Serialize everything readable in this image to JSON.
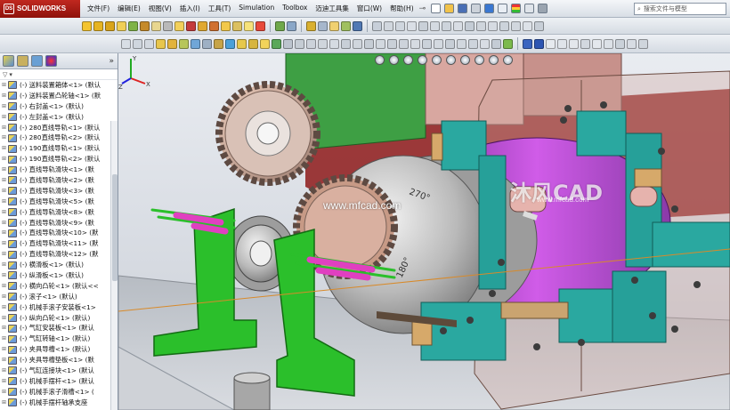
{
  "app": {
    "name": "SOLIDWORKS",
    "ds_mark": "DS"
  },
  "menu": {
    "items": [
      "文件(F)",
      "编辑(E)",
      "视图(V)",
      "插入(I)",
      "工具(T)",
      "Simulation",
      "Toolbox",
      "迈迪工具集",
      "窗口(W)",
      "帮助(H)"
    ]
  },
  "search": {
    "placeholder": "搜索文件与模型"
  },
  "feature_tree": {
    "items": [
      "(-) 送料装置箱体<1> (默认",
      "(-) 送料装置凸轮轴<1> (默",
      "(-) 右封盖<1> (默认)",
      "(-) 左封盖<1> (默认)",
      "(-) 280直线导轨<1> (默认",
      "(-) 280直线导轨<2> (默认",
      "(-) 190直线导轨<1> (默认",
      "(-) 190直线导轨<2> (默认",
      "(-) 直线导轨滑块<1> (默",
      "(-) 直线导轨滑块<2> (默",
      "(-) 直线导轨滑块<3> (默",
      "(-) 直线导轨滑块<5> (默",
      "(-) 直线导轨滑块<8> (默",
      "(-) 直线导轨滑块<9> (默",
      "(-) 直线导轨滑块<10> (默",
      "(-) 直线导轨滑块<11> (默",
      "(-) 直线导轨滑块<12> (默",
      "(-) 横滑板<1> (默认)",
      "(-) 纵滑板<1> (默认)",
      "(-) 横向凸轮<1> (默认<<",
      "(-) 滚子<1> (默认)",
      "(-) 机械手滚子安装板<1>",
      "(-) 纵向凸轮<1> (默认)",
      "(-) 气缸安装板<1> (默认",
      "(-) 气缸转轴<1> (默认)",
      "(-) 夹具导槽<1> (默认)",
      "(-) 夹具导槽垫板<1> (默",
      "(-) 气缸连接块<1> (默认",
      "(-) 机械手摆杆<1> (默认",
      "(-) 机械手滚子滑槽<1> (",
      "(-) 机械手摆杆轴承支座"
    ]
  },
  "viewport": {
    "watermark_cn": "沐风CAD",
    "watermark_url": "www.mfcad.com",
    "watermark_url_small": "www.mfcad.com",
    "gear_label_1": "270°",
    "gear_label_2": "180°",
    "triad_x": "X",
    "triad_y": "Y",
    "triad_z": "Z"
  },
  "colors": {
    "brand_red": "#b3221a",
    "green_bracket": "#2bbf2b",
    "teal_blocks": "#2aa8a0",
    "purple_cam": "#b03ad0",
    "magenta_pins": "#e040c0"
  }
}
